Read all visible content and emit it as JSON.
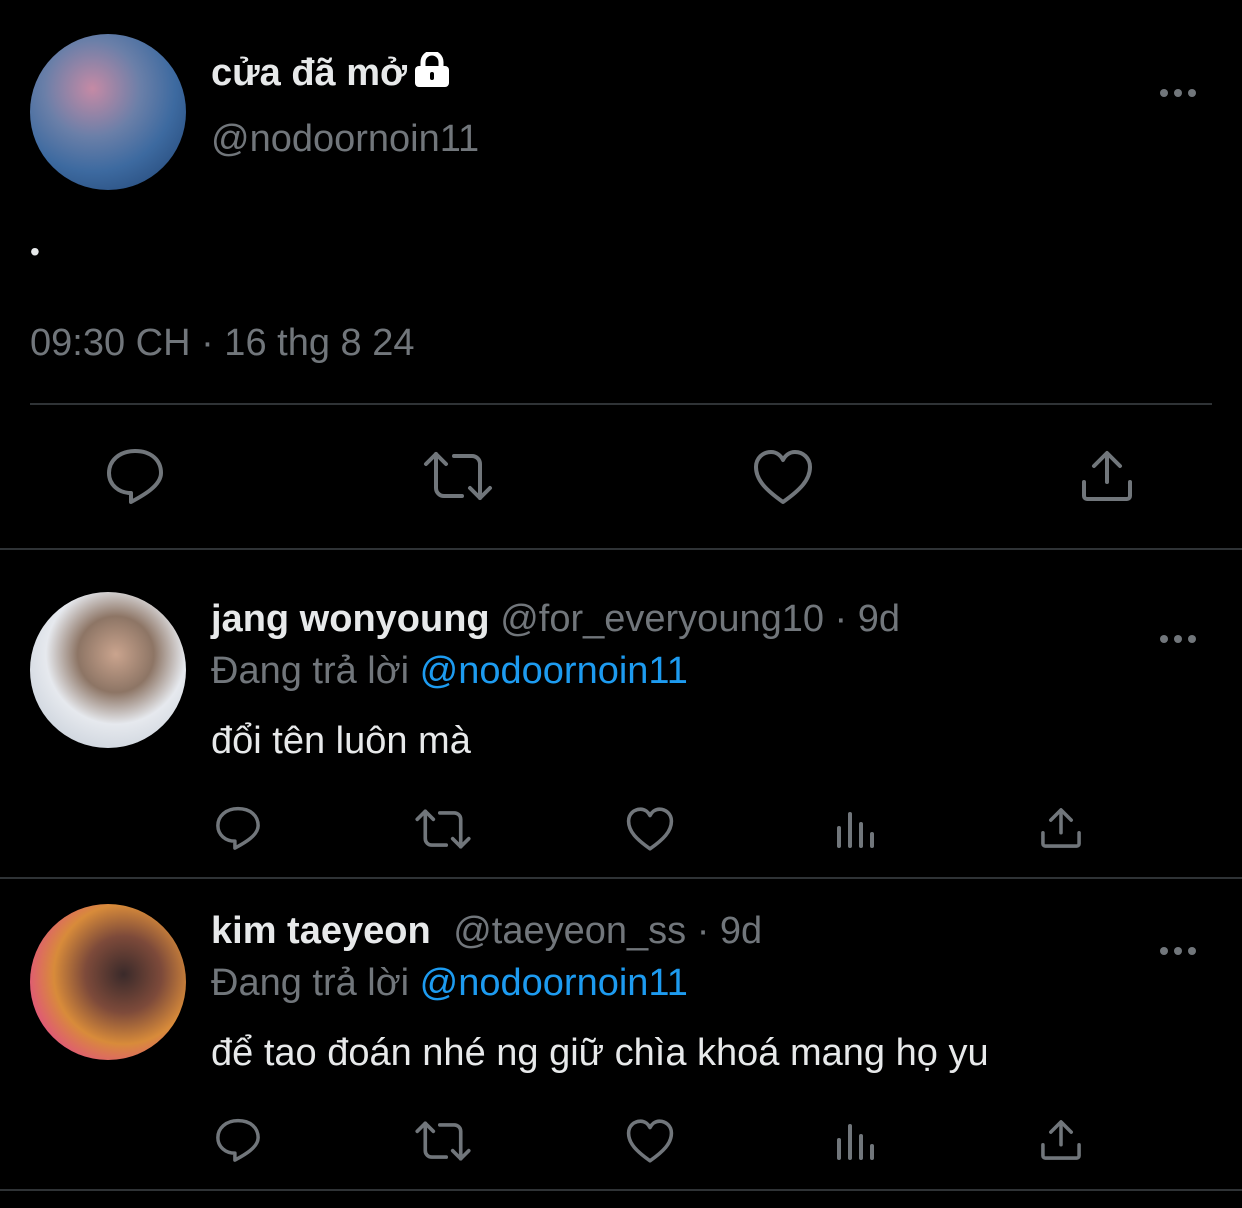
{
  "main_tweet": {
    "display_name": "cửa đã mở",
    "handle": "@nodoornoin11",
    "text": "•",
    "timestamp": "09:30 CH · 16 thg 8 24",
    "more_icon": "more-horizontal-icon",
    "lock_icon": "lock-icon"
  },
  "replies": [
    {
      "display_name": "jang wonyoung",
      "handle": "@for_everyoung10 · 9d",
      "reply_label": "Đang trả lời ",
      "reply_to": "@nodoornoin11",
      "text": "đổi tên luôn mà"
    },
    {
      "display_name": "kim taeyeon",
      "handle": "@taeyeon_ss · 9d",
      "reply_label": "Đang trả lời ",
      "reply_to": "@nodoornoin11",
      "text": "để tao đoán nhé ng giữ chìa khoá mang họ yu"
    }
  ],
  "colors": {
    "background": "#000000",
    "text": "#e7e9ea",
    "secondary": "#71767b",
    "accent": "#1d9bf0",
    "divider": "#2f3336"
  }
}
